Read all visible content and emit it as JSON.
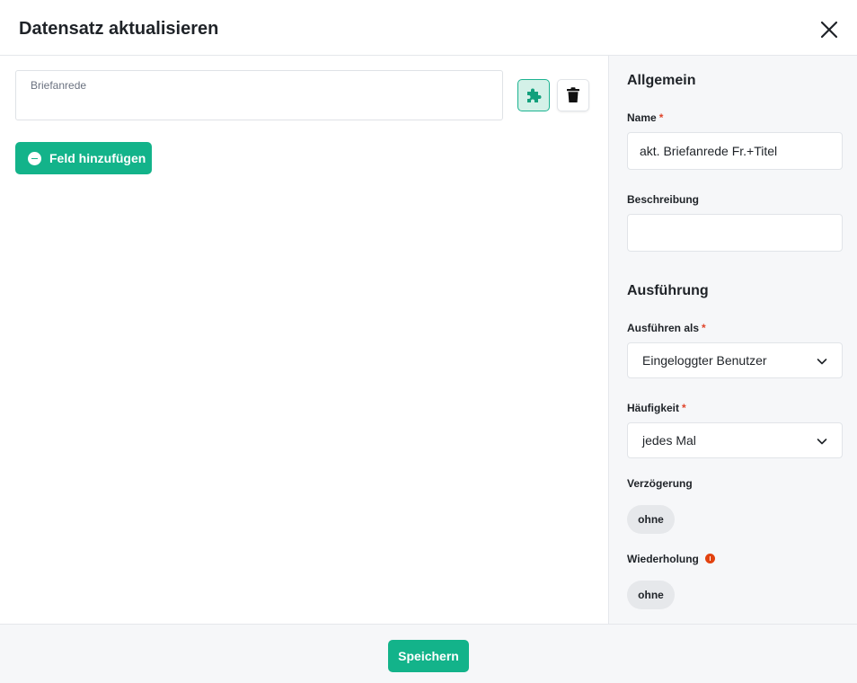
{
  "dialog": {
    "title": "Datensatz aktualisieren",
    "close_icon": "close-icon"
  },
  "main": {
    "field": {
      "label": "Briefanrede",
      "value": ""
    },
    "icons": {
      "plugin": "puzzle-icon",
      "delete": "trash-icon"
    },
    "add_field_label": "Feld hinzufügen"
  },
  "sidebar": {
    "general": {
      "heading": "Allgemein",
      "name_label": "Name",
      "name_value": "akt. Briefanrede Fr.+Titel",
      "description_label": "Beschreibung",
      "description_value": ""
    },
    "execution": {
      "heading": "Ausführung",
      "run_as_label": "Ausführen als",
      "run_as_value": "Eingeloggter Benutzer",
      "frequency_label": "Häufigkeit",
      "frequency_value": "jedes Mal",
      "delay_label": "Verzögerung",
      "delay_value": "ohne",
      "repeat_label": "Wiederholung",
      "repeat_value": "ohne"
    },
    "required_marker": "*"
  },
  "footer": {
    "save_label": "Speichern"
  },
  "colors": {
    "accent": "#13b38a",
    "required": "#e0452b",
    "info": "#e2420f",
    "panel": "#f6f7f9"
  }
}
